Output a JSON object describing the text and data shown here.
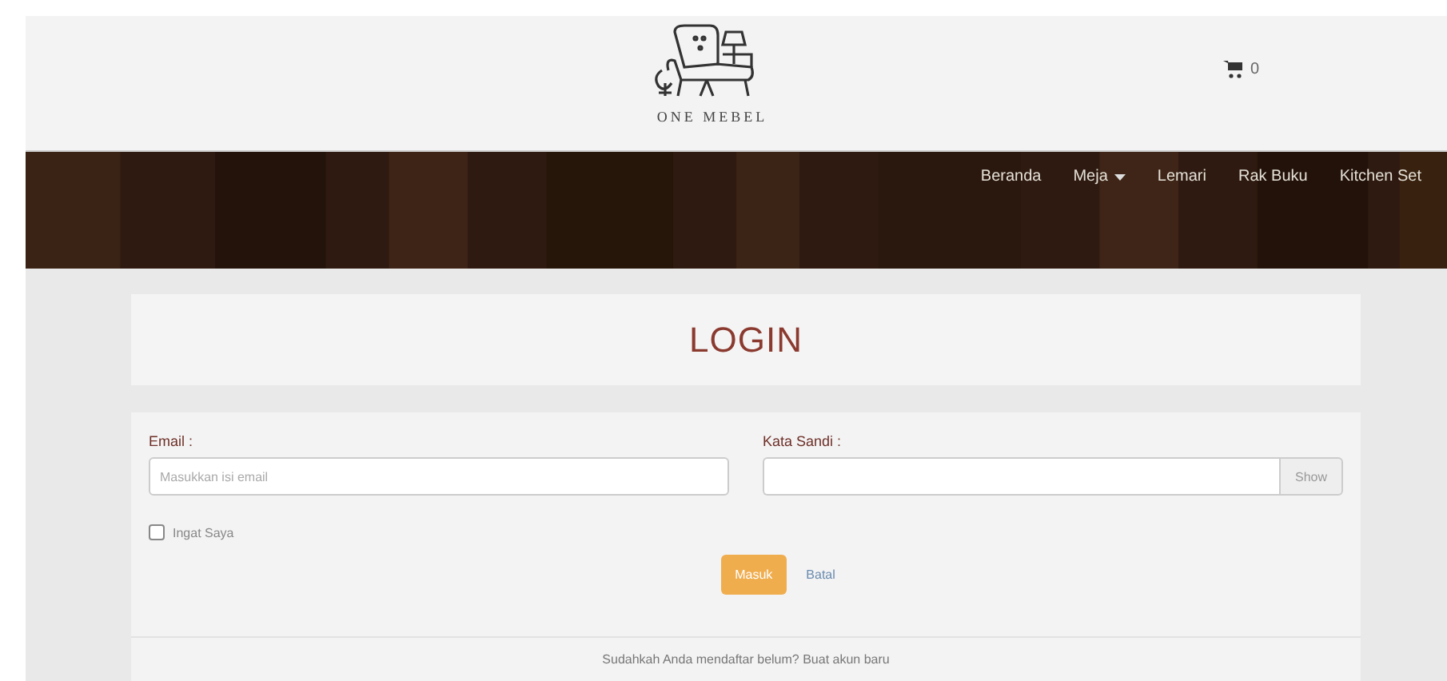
{
  "header": {
    "logo_text": "ONE MEBEL",
    "cart_count": "0"
  },
  "nav": [
    {
      "label": "Beranda",
      "dropdown": false
    },
    {
      "label": "Meja",
      "dropdown": true
    },
    {
      "label": "Lemari",
      "dropdown": false
    },
    {
      "label": "Rak Buku",
      "dropdown": false
    },
    {
      "label": "Kitchen Set",
      "dropdown": false
    }
  ],
  "login": {
    "title": "LOGIN",
    "email": {
      "label": "Email :",
      "placeholder": "Masukkan isi email"
    },
    "password": {
      "label": "Kata Sandi :",
      "toggle": "Show"
    },
    "remember": {
      "label": "Ingat Saya",
      "checked": false
    },
    "submit": "Masuk",
    "cancel": "Batal",
    "footer": "Sudahkah Anda mendaftar belum? Buat akun baru"
  }
}
